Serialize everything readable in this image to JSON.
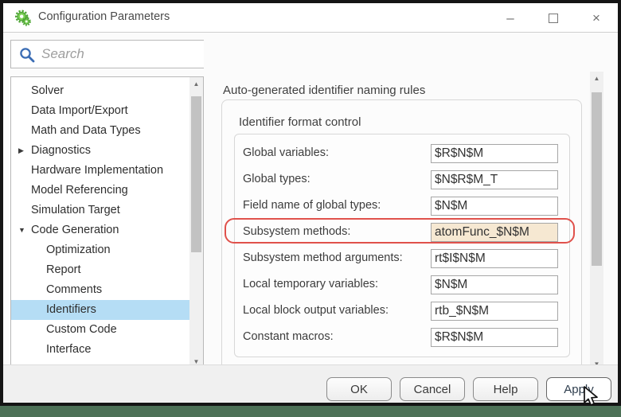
{
  "window": {
    "title": "Configuration Parameters",
    "controls": {
      "minimize": "–",
      "close": "×"
    }
  },
  "search": {
    "placeholder": "Search"
  },
  "sidebar": {
    "items": [
      {
        "label": "Solver",
        "level": 1,
        "arrow": ""
      },
      {
        "label": "Data Import/Export",
        "level": 1,
        "arrow": ""
      },
      {
        "label": "Math and Data Types",
        "level": 1,
        "arrow": ""
      },
      {
        "label": "Diagnostics",
        "level": 1,
        "arrow": "collapsed"
      },
      {
        "label": "Hardware Implementation",
        "level": 1,
        "arrow": ""
      },
      {
        "label": "Model Referencing",
        "level": 1,
        "arrow": ""
      },
      {
        "label": "Simulation Target",
        "level": 1,
        "arrow": ""
      },
      {
        "label": "Code Generation",
        "level": 1,
        "arrow": "expanded"
      },
      {
        "label": "Optimization",
        "level": 2,
        "arrow": ""
      },
      {
        "label": "Report",
        "level": 2,
        "arrow": ""
      },
      {
        "label": "Comments",
        "level": 2,
        "arrow": ""
      },
      {
        "label": "Identifiers",
        "level": 2,
        "arrow": "",
        "selected": true
      },
      {
        "label": "Custom Code",
        "level": 2,
        "arrow": ""
      },
      {
        "label": "Interface",
        "level": 2,
        "arrow": ""
      }
    ]
  },
  "main": {
    "heading": "Auto-generated identifier naming rules",
    "group_title": "Identifier format control",
    "fields": [
      {
        "label": "Global variables:",
        "value": "$R$N$M"
      },
      {
        "label": "Global types:",
        "value": "$N$R$M_T"
      },
      {
        "label": "Field name of global types:",
        "value": "$N$M"
      },
      {
        "label": "Subsystem methods:",
        "value": "atomFunc_$N$M",
        "highlighted": true
      },
      {
        "label": "Subsystem method arguments:",
        "value": "rt$I$N$M"
      },
      {
        "label": "Local temporary variables:",
        "value": "$N$M"
      },
      {
        "label": "Local block output variables:",
        "value": "rtb_$N$M"
      },
      {
        "label": "Constant macros:",
        "value": "$R$N$M"
      }
    ]
  },
  "footer": {
    "buttons": [
      "OK",
      "Cancel",
      "Help",
      "Apply"
    ],
    "primary": "Apply"
  },
  "icons": {
    "app": "gears-icon",
    "search": "search-icon",
    "collapsed": "chevron-right-icon",
    "expanded": "chevron-down-icon"
  },
  "colors": {
    "selection": "#b5ddf5",
    "highlight_border": "#e0514b",
    "highlight_fill": "#f6e8d2",
    "desktop_green": "#4d7157",
    "search_icon_blue": "#3a6cb4",
    "app_icon_green": "#6cc24a"
  }
}
